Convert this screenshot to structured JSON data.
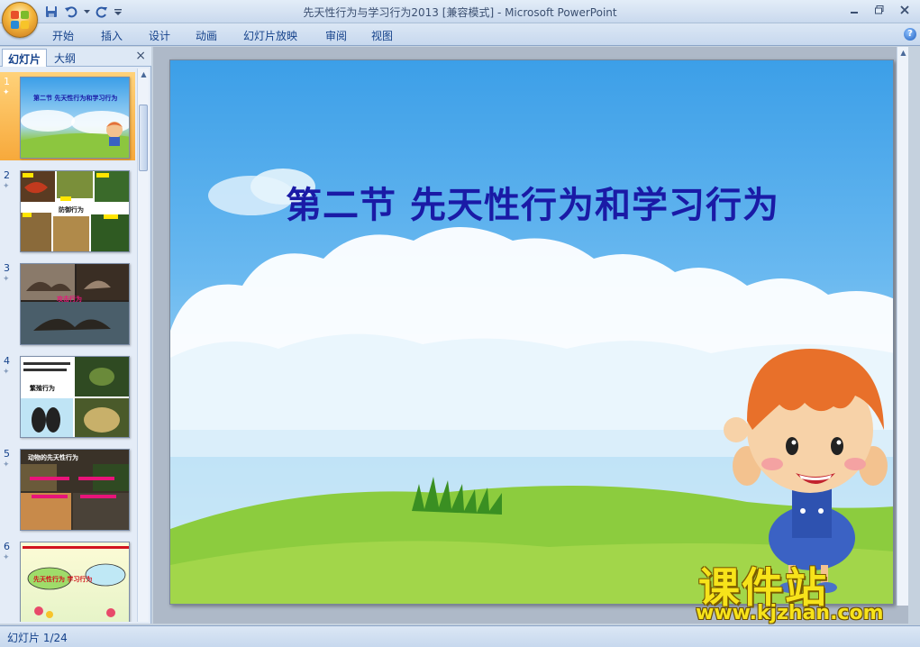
{
  "window": {
    "title": "先天性行为与学习行为2013 [兼容模式] - Microsoft PowerPoint",
    "controls": [
      "minimize",
      "maximize",
      "close"
    ]
  },
  "quick_access": {
    "icons": [
      "save-icon",
      "undo-icon",
      "redo-icon",
      "customize-icon"
    ]
  },
  "ribbon_tabs": [
    "开始",
    "插入",
    "设计",
    "动画",
    "幻灯片放映",
    "审阅",
    "视图"
  ],
  "left_pane": {
    "tabs": [
      "幻灯片",
      "大纲"
    ],
    "active_tab": "幻灯片",
    "close_label": "×",
    "slides": [
      {
        "number": "1",
        "caption": "第二节 先天性行为和学习行为",
        "selected": true
      },
      {
        "number": "2",
        "caption": "防御行为",
        "selected": false
      },
      {
        "number": "3",
        "caption": "攻击行为",
        "selected": false
      },
      {
        "number": "4",
        "caption": "繁殖行为",
        "selected": false
      },
      {
        "number": "5",
        "caption": "动物的先天性行为",
        "selected": false
      },
      {
        "number": "6",
        "caption": "先天性行为 学习行为",
        "selected": false
      }
    ]
  },
  "slide": {
    "title": "第二节 先天性行为和学习行为"
  },
  "watermark": {
    "chinese": "课件站",
    "url": "www.kjzhan.com"
  },
  "status_bar": {
    "slide_indicator": "幻灯片 1/24"
  },
  "colors": {
    "title_text": "#1a1aa6",
    "selection": "#f7a93b",
    "watermark": "#f7e31a"
  }
}
